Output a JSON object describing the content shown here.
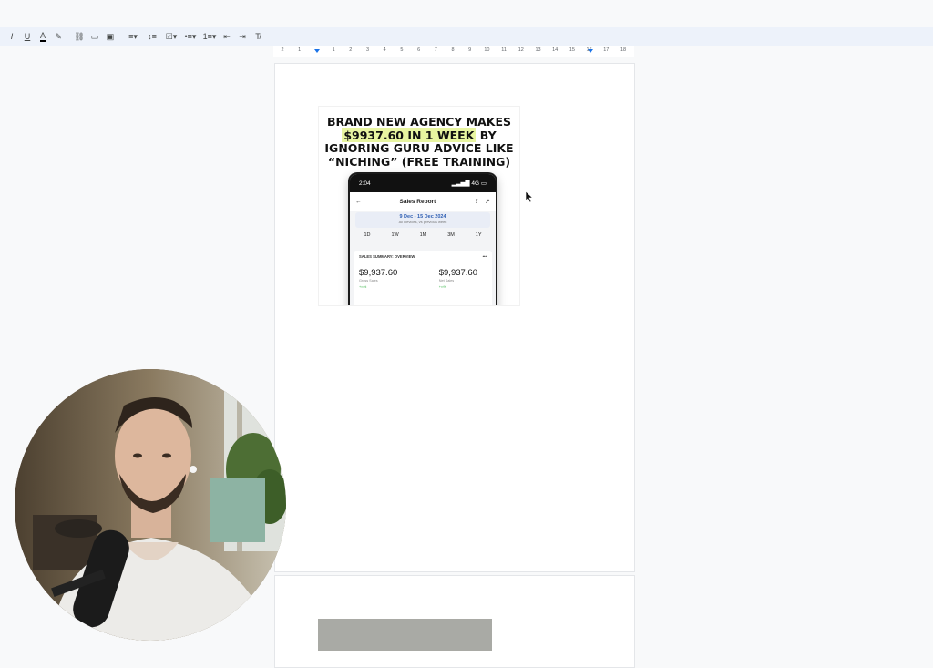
{
  "toolbar": {
    "buttons": [
      {
        "name": "italic",
        "glyph": "I"
      },
      {
        "name": "underline",
        "glyph": "U"
      },
      {
        "name": "text-color",
        "glyph": "A"
      },
      {
        "name": "highlight",
        "glyph": "✎"
      },
      {
        "name": "link",
        "glyph": "⛓"
      },
      {
        "name": "comment",
        "glyph": "▭"
      },
      {
        "name": "image",
        "glyph": "▣"
      },
      {
        "name": "align",
        "glyph": "≡▾"
      },
      {
        "name": "line-spacing",
        "glyph": "↕≡"
      },
      {
        "name": "checklist",
        "glyph": "☑▾"
      },
      {
        "name": "bulleted-list",
        "glyph": "•≡▾"
      },
      {
        "name": "numbered-list",
        "glyph": "1≡▾"
      },
      {
        "name": "decrease-indent",
        "glyph": "⇤"
      },
      {
        "name": "increase-indent",
        "glyph": "⇥"
      },
      {
        "name": "clear-formatting",
        "glyph": "T̸"
      }
    ]
  },
  "ruler": {
    "labels": [
      "2",
      "1",
      "",
      "1",
      "2",
      "3",
      "4",
      "5",
      "6",
      "7",
      "8",
      "9",
      "10",
      "11",
      "12",
      "13",
      "14",
      "15",
      "16",
      "17",
      "18"
    ]
  },
  "ad": {
    "headline_line1": "BRAND NEW AGENCY MAKES",
    "headline_highlight": "$9937.60 IN 1 WEEK",
    "headline_after_highlight": " BY",
    "headline_line3": "IGNORING GURU ADVICE LIKE",
    "headline_line4": "“NICHING” (FREE TRAINING)",
    "phone": {
      "time": "2:04",
      "signal": "4G",
      "title": "Sales Report",
      "date_range": "9 Dec - 15 Dec 2024",
      "date_subtitle": "All Devices, vs previous week",
      "periods": [
        "1D",
        "1W",
        "1M",
        "3M",
        "1Y"
      ],
      "summary_title": "SALES SUMMARY: OVERVIEW",
      "metrics": [
        {
          "value": "$9,937.60",
          "label": "Gross Sales",
          "change": "+∞%"
        },
        {
          "value": "$9,937.60",
          "label": "Net Sales",
          "change": "+∞%"
        }
      ]
    }
  },
  "colors": {
    "toolbar_bg": "#edf2fa",
    "page_bg": "#ffffff",
    "canvas_bg": "#f8f9fa",
    "highlight": "#e8f5a0",
    "date_accent": "#2f5fb3",
    "positive": "#3bb54a"
  }
}
